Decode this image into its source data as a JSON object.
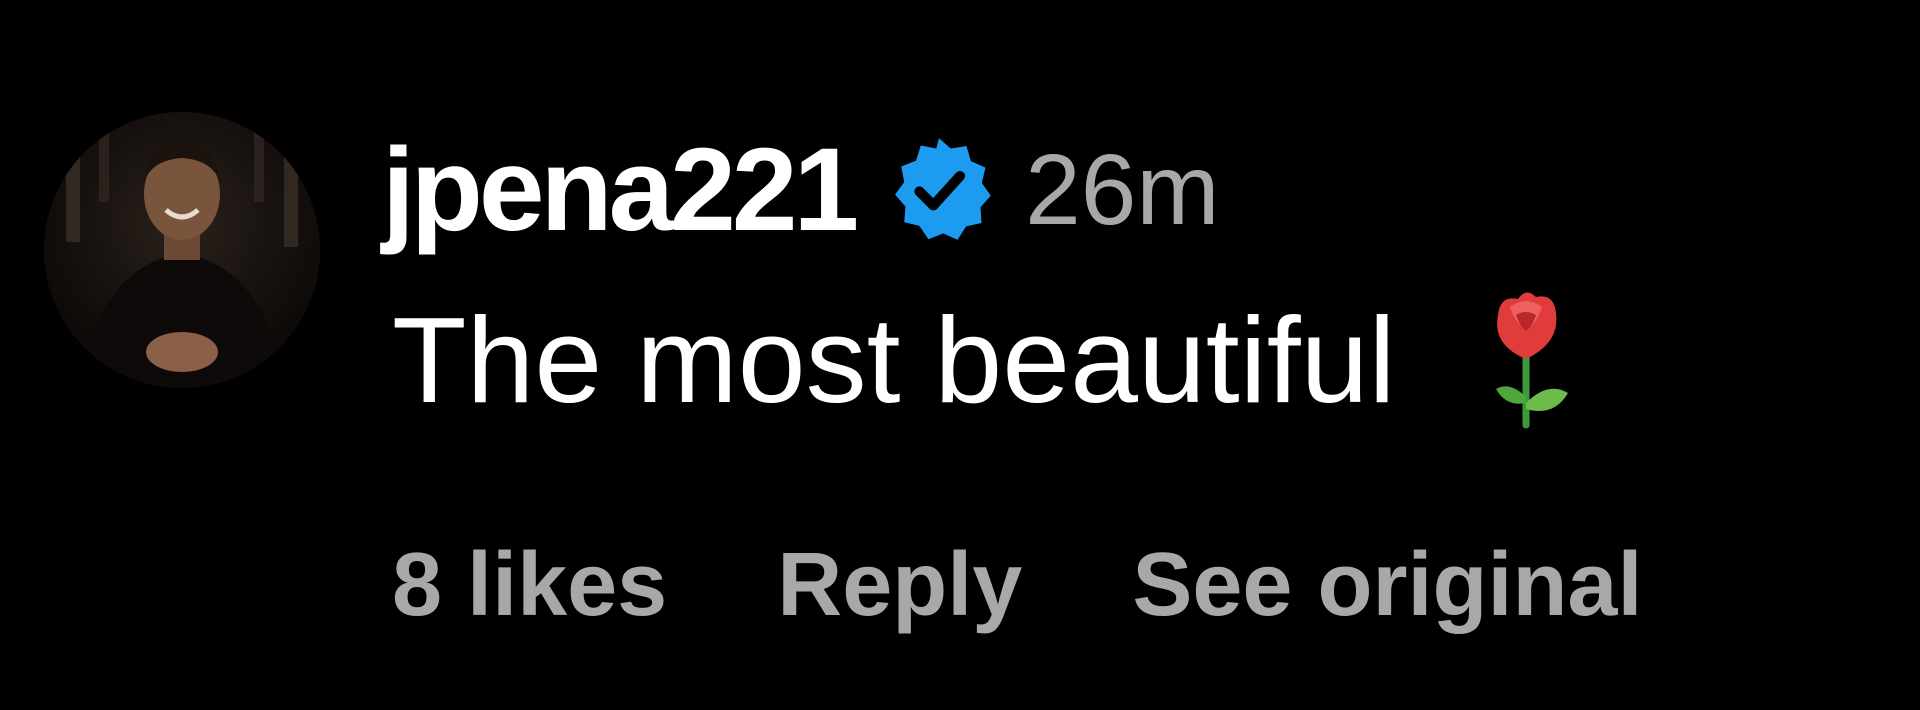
{
  "comment": {
    "username": "jpena221",
    "verified_icon": "verified-badge-icon",
    "timestamp": "26m",
    "text": "The most beautiful",
    "emoji_icon": "rose-emoji-icon",
    "avatar_icon": "profile-avatar"
  },
  "actions": {
    "likes_label": "8 likes",
    "reply_label": "Reply",
    "see_original_label": "See original"
  },
  "colors": {
    "background": "#000000",
    "username": "#ffffff",
    "comment_text": "#ffffff",
    "secondary_text": "#a8a8a8",
    "verified_badge": "#1d9bf0"
  }
}
